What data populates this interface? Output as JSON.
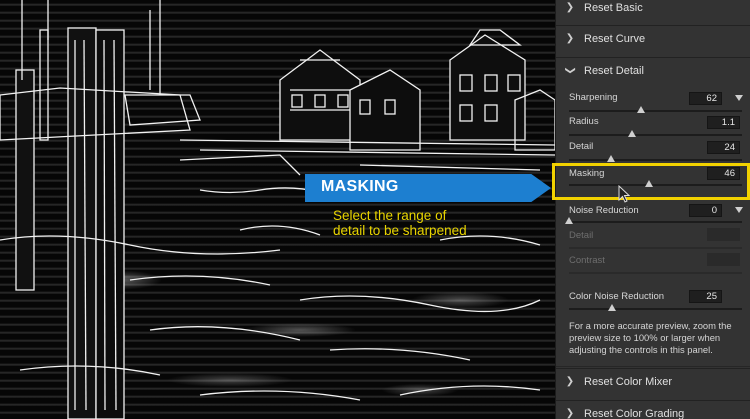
{
  "callout": {
    "title": "MASKING",
    "description": "Select the range of detail to be sharpened"
  },
  "panel": {
    "sections_top": [
      {
        "label": "Reset Basic",
        "state": "collapsed"
      },
      {
        "label": "Reset Curve",
        "state": "collapsed"
      },
      {
        "label": "Reset Detail",
        "state": "expanded"
      }
    ],
    "detail": {
      "sharpening": {
        "label": "Sharpening",
        "value": "62",
        "level": 62,
        "max": 150
      },
      "radius": {
        "label": "Radius",
        "value": "1.1",
        "level": 1.1,
        "max": 3
      },
      "detail": {
        "label": "Detail",
        "value": "24",
        "level": 24,
        "max": 100
      },
      "masking": {
        "label": "Masking",
        "value": "46",
        "level": 46,
        "max": 100
      },
      "noise_reduction": {
        "label": "Noise Reduction",
        "value": "0",
        "level": 0,
        "max": 100
      },
      "nr_detail": {
        "label": "Detail",
        "value": ""
      },
      "nr_contrast": {
        "label": "Contrast",
        "value": ""
      },
      "color_noise_reduction": {
        "label": "Color Noise Reduction",
        "value": "25",
        "level": 25,
        "max": 100
      }
    },
    "note": "For a more accurate preview, zoom the preview size to 100% or larger when adjusting the controls in this panel.",
    "sections_bottom": [
      {
        "label": "Reset Color Mixer",
        "state": "collapsed"
      },
      {
        "label": "Reset Color Grading",
        "state": "collapsed"
      }
    ]
  },
  "icons": {
    "collapsed": "chevron-right-icon",
    "expanded": "chevron-down-icon",
    "slider_thumb": "slider-thumb-icon",
    "dropdown": "dropdown-triangle-icon",
    "cursor": "mouse-pointer-icon"
  },
  "colors": {
    "callout_bg": "#1d7fd0",
    "callout_desc": "#e9d500",
    "highlight": "#f2d200",
    "panel_bg": "#333333"
  }
}
